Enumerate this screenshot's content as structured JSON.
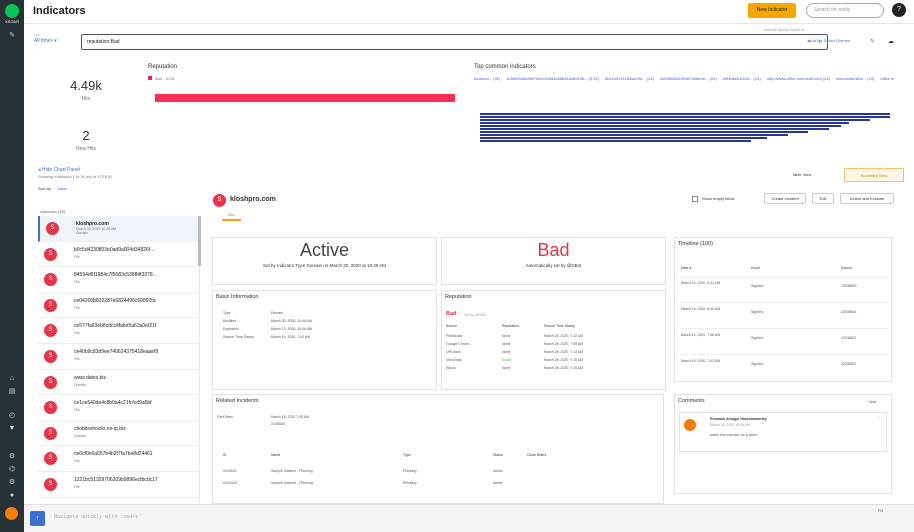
{
  "nav": {
    "logo_text": "XSOAR"
  },
  "header": {
    "title": "Indicators",
    "new_button": "New Indicator",
    "search_placeholder": "Search for entity",
    "help": "?"
  },
  "query": {
    "time_label": "Last",
    "time_value": "All times ▾",
    "value": "reputation:Bad",
    "clear": "✕",
    "search": "⌕",
    "autoquery": "Normal Query Scroll Is",
    "fav_label": "Add Re Saved Queries"
  },
  "stats": {
    "hits": "4.49k",
    "hits_label": "Hits",
    "new_hits": "2",
    "new_hits_label": "New Hits"
  },
  "reputation": {
    "title": "Reputation",
    "legend": "Bad - 4728",
    "bar_value": 1.0
  },
  "top": {
    "title": "Top common indicators",
    "chips": [
      "Bookma... (2k)",
      "1050e05a0c98f72eec9c0d4c88b54a4e0496... (0.24)",
      "bbc1d57e1c95da7ed... (24)",
      "5d6f9bd50c39de7cb8e0e... (24)",
      "b9f4a8ee1f2cd... (24)",
      "http://www.office.microsoft.com (24)",
      "microsoftonline... (24)",
      "office.microsoft.com (24)",
      "e9e6b9f8e86b6bc2 (24)",
      "win-tvdrm93g8ui (24)",
      "office.microsoft.com... (24)",
      "exchange.oap...(24)",
      "http://www.office.microsoft.com (24)"
    ],
    "bars": [
      1.0,
      1.0,
      0.95,
      0.9,
      0.88,
      0.85,
      0.8,
      0.75,
      0.7,
      0.66
    ]
  },
  "panel": {
    "hide_label": "◂ Hide Chart Panel",
    "showing": "Showing indicators 1 to 50 out of 472,816",
    "sort_label": "Sort by:",
    "sort_value": "Value",
    "table_view": "Table View",
    "summary_view": "Summary View",
    "group": "Unknown (33)"
  },
  "list": [
    {
      "icon": "S",
      "name": "kloshpro.com",
      "date": "March 30, 2020 10:46 AM",
      "type": "Domain"
    },
    {
      "icon": "S",
      "name": "b0c5d4230803e0ad9a004d34826f...",
      "date": "",
      "type": "File"
    },
    {
      "icon": "S",
      "name": "84594d6f1984c7f5683c53884f3278...",
      "date": "",
      "type": "File"
    },
    {
      "icon": "S",
      "name": "ce04206b832287e6824496c60892fa",
      "date": "",
      "type": "File"
    },
    {
      "icon": "S",
      "name": "ce577fa63eb8cdcc4fabe5a63a0ef21f",
      "date": "",
      "type": "File"
    },
    {
      "icon": "S",
      "name": "ce40b9c83d9ee740624375418eaaef9",
      "date": "",
      "type": "File"
    },
    {
      "icon": "S",
      "name": "www.dates.biz",
      "date": "",
      "type": "Domain"
    },
    {
      "icon": "S",
      "name": "ce1ce640de4c8b0a4c21fcfcd9a5bf",
      "date": "",
      "type": "File"
    },
    {
      "icon": "S",
      "name": "cbobitsshocks.no-ip.biz",
      "date": "",
      "type": "Domain"
    },
    {
      "icon": "S",
      "name": "ce6cf0e6a657b4b2f7fa7be8d24461",
      "date": "",
      "type": "File"
    },
    {
      "icon": "S",
      "name": "1221bc51329706209b9896ecfbcdc17",
      "date": "",
      "type": "File"
    }
  ],
  "detail": {
    "name": "kloshpro.com",
    "tab": "Info",
    "show_empty": "Show empty fields",
    "create_incident": "Create Incident",
    "edit": "Edit",
    "delete": "Delete and Exclude",
    "status": {
      "value": "Active",
      "note": "Set by Indicator Type Domain on March 30, 2020 at 10:46 AM"
    },
    "verdict": {
      "value": "Bad",
      "note": "Automatically set by @DBot"
    },
    "basic": {
      "title": "Basic Information",
      "rows": [
        {
          "k": "Type",
          "v": "Domain"
        },
        {
          "k": "Modified",
          "v": "March 30, 2020, 10:46 AM"
        },
        {
          "k": "Expiration",
          "v": "March 13, 2020, 10:46 AM"
        },
        {
          "k": "Source Time Stamp",
          "v": "March 16, 2020, 7:02 AM"
        }
      ]
    },
    "rep": {
      "title": "Reputation",
      "verdict": "Bad",
      "verdict_sub": "Set by @DBot",
      "headers": [
        "Source",
        "Reputation",
        "Source Time Stamp"
      ],
      "rows": [
        {
          "s": "PhishLabs",
          "r": "None",
          "t": "March 28, 2020, 7:12 AM"
        },
        {
          "s": "Google Chrom...",
          "r": "None",
          "t": "March 28, 2020, 7:05 AM"
        },
        {
          "s": "URLhaus",
          "r": "None",
          "t": "March 28, 2020, 7:13 AM"
        },
        {
          "s": "VirusTotal",
          "r": "Good",
          "t": "March 28, 2020, 7:15 AM"
        },
        {
          "s": "Whois",
          "r": "None",
          "t": "March 28, 2020, 7:15 AM"
        }
      ]
    },
    "timeline": {
      "title": "Timeline (100)",
      "headers": [
        "Date ▾",
        "Event",
        "Source"
      ],
      "rows": [
        {
          "d": "March 14, 2020, 5:41 AM",
          "e": "Sighted",
          "s": "22038609"
        },
        {
          "d": "March 14, 2020, 6:00 AM",
          "e": "Sighted",
          "s": "22038601"
        },
        {
          "d": "March 14, 2020, 7:58 AM",
          "e": "Sighted",
          "s": "22038601"
        },
        {
          "d": "March 16, 2020, 7:02 AM",
          "e": "Sighted",
          "s": "22038601"
        }
      ]
    },
    "related": {
      "title": "Related Incidents",
      "first_seen_label": "First Seen",
      "first_seen_date": "March 16, 2020 7:08 AM",
      "first_seen_link": "2208508",
      "headers": [
        "ID",
        "Name",
        "Type",
        "Status",
        "Close Notes"
      ],
      "rows": [
        {
          "id": "#204022",
          "name": "Sample Incident - Phishing",
          "type": "Phishing",
          "status": "Active"
        },
        {
          "id": "#204018",
          "name": "Sample Incident - Phishing",
          "type": "Phishing",
          "status": "Active"
        }
      ]
    },
    "comments": {
      "title": "Comments",
      "add": "+ Add",
      "author": "Promukh Arlulgul Ganeshamurthy",
      "date": "March 30, 2020 10:46 AM",
      "text": "watch this indicator for a week"
    }
  },
  "footer": {
    "prompt": "Navigate quickly with 'cmd+k'",
    "label": "PN"
  }
}
